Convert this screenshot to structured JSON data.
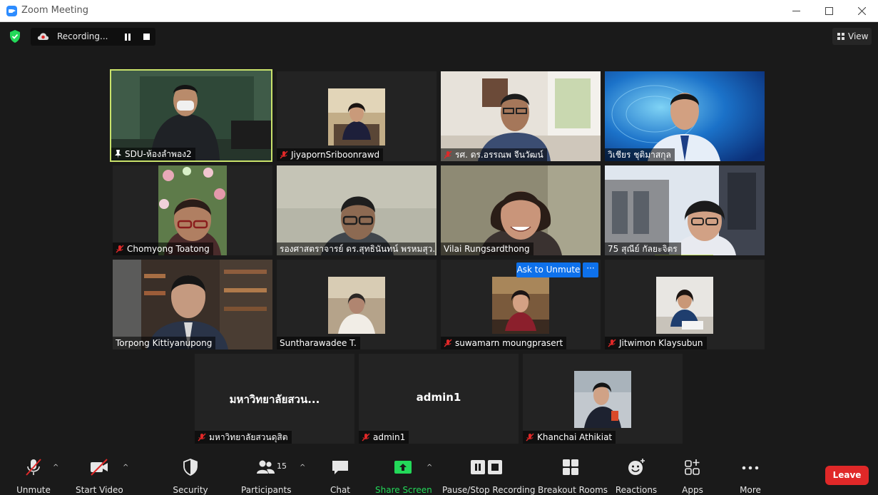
{
  "window": {
    "title": "Zoom Meeting"
  },
  "recording": {
    "label": "Recording..."
  },
  "view": {
    "label": "View"
  },
  "participants": [
    {
      "name": "SDU-ห้องลำพอง2",
      "muted": false,
      "pinned": true,
      "active": true
    },
    {
      "name": "JiyapornSriboonrawd",
      "muted": true
    },
    {
      "name": "รศ. ดร.อรรณพ จีนวัฒน์",
      "muted": true
    },
    {
      "name": "วิเชียร ชุติมาสกุล",
      "muted": false
    },
    {
      "name": "Chomyong Toatong",
      "muted": true
    },
    {
      "name": "รองศาสตราจารย์ ดร.สุทธินันทน์ พรหมสุว...",
      "muted": false
    },
    {
      "name": "Vilai Rungsardthong",
      "muted": false
    },
    {
      "name": "75 สุณีย์ กัลยะจิตร",
      "muted": false
    },
    {
      "name": "Torpong Kittiyanupong",
      "muted": false
    },
    {
      "name": "Suntharawadee T.",
      "muted": false
    },
    {
      "name": "suwamarn moungprasert",
      "muted": true
    },
    {
      "name": "Jitwimon Klaysubun",
      "muted": true
    },
    {
      "name": "มหาวิทยาลัยสวนดุสิต",
      "display": "มหาวิทยาลัยสวน...",
      "muted": true
    },
    {
      "name": "admin1",
      "display": "admin1",
      "muted": true
    },
    {
      "name": "Khanchai Athikiat",
      "muted": true
    }
  ],
  "hover": {
    "ask_label": "Ask to Unmute",
    "more_label": "···"
  },
  "toolbar": {
    "unmute": "Unmute",
    "start_video": "Start Video",
    "security": "Security",
    "participants": "Participants",
    "participants_count": "15",
    "chat": "Chat",
    "share_screen": "Share Screen",
    "pause_stop": "Pause/Stop Recording",
    "breakout": "Breakout Rooms",
    "reactions": "Reactions",
    "apps": "Apps",
    "more": "More",
    "leave": "Leave"
  },
  "colors": {
    "accent": "#0e71eb",
    "active_speaker": "#c9e26b",
    "share": "#23d959",
    "leave": "#e02828",
    "muted": "#e02828"
  }
}
